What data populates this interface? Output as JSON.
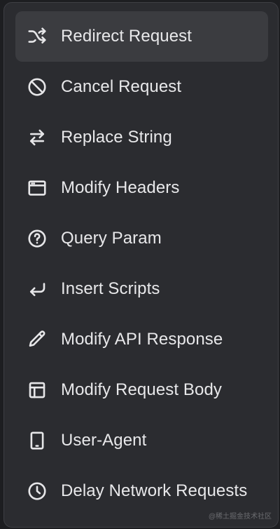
{
  "menu": {
    "items": [
      {
        "label": "Redirect Request",
        "icon": "shuffle-icon",
        "active": true
      },
      {
        "label": "Cancel Request",
        "icon": "block-icon",
        "active": false
      },
      {
        "label": "Replace String",
        "icon": "swap-arrows-icon",
        "active": false
      },
      {
        "label": "Modify Headers",
        "icon": "browser-window-icon",
        "active": false
      },
      {
        "label": "Query Param",
        "icon": "help-circle-icon",
        "active": false
      },
      {
        "label": "Insert Scripts",
        "icon": "return-arrow-icon",
        "active": false
      },
      {
        "label": "Modify API Response",
        "icon": "pencil-icon",
        "active": false
      },
      {
        "label": "Modify Request Body",
        "icon": "layout-icon",
        "active": false
      },
      {
        "label": "User-Agent",
        "icon": "tablet-icon",
        "active": false
      },
      {
        "label": "Delay Network Requests",
        "icon": "clock-icon",
        "active": false
      }
    ]
  },
  "watermark": "@稀土掘金技术社区",
  "colors": {
    "menu_background": "#2b2c30",
    "active_item_background": "#3b3c40",
    "text": "#e8e8ea"
  }
}
